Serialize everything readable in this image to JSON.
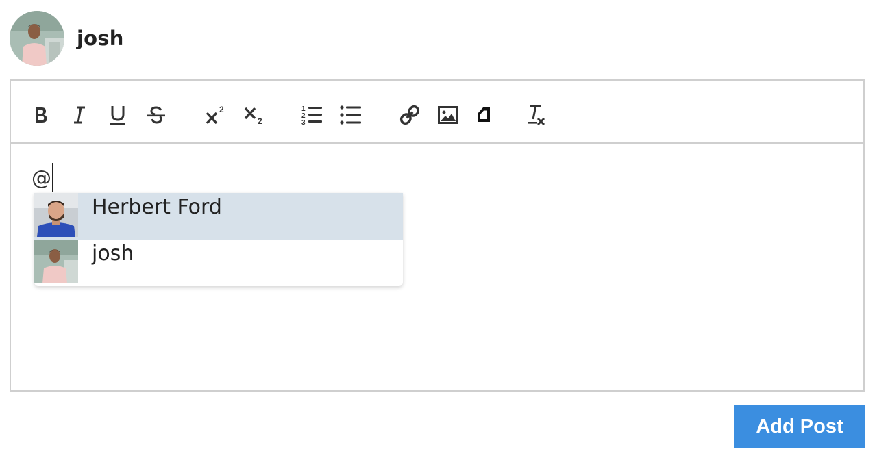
{
  "post_author": {
    "name": "josh",
    "avatar_icon": "user-photo-icon"
  },
  "toolbar": {
    "buttons": [
      {
        "name": "bold",
        "glyph": "B"
      },
      {
        "name": "italic",
        "glyph": "I"
      },
      {
        "name": "underline",
        "glyph": "U"
      },
      {
        "name": "strikethrough",
        "glyph": "S"
      },
      {
        "name": "superscript",
        "glyph": "x²"
      },
      {
        "name": "subscript",
        "glyph": "x₂"
      },
      {
        "name": "ordered-list",
        "glyph": "ordered-list-icon"
      },
      {
        "name": "bullet-list",
        "glyph": "bullet-list-icon"
      },
      {
        "name": "link",
        "glyph": "link-icon"
      },
      {
        "name": "image",
        "glyph": "image-icon"
      },
      {
        "name": "video",
        "glyph": "video-icon"
      },
      {
        "name": "clear-format",
        "glyph": "clear-format-icon"
      }
    ]
  },
  "editor": {
    "typed_text": "@"
  },
  "mention_suggestions": [
    {
      "name": "Herbert Ford",
      "selected": true
    },
    {
      "name": "josh",
      "selected": false
    }
  ],
  "submit": {
    "label": "Add Post"
  },
  "colors": {
    "accent": "#3b8ee0",
    "selected_row": "#d7e1ea",
    "border": "#cfcfcf"
  }
}
